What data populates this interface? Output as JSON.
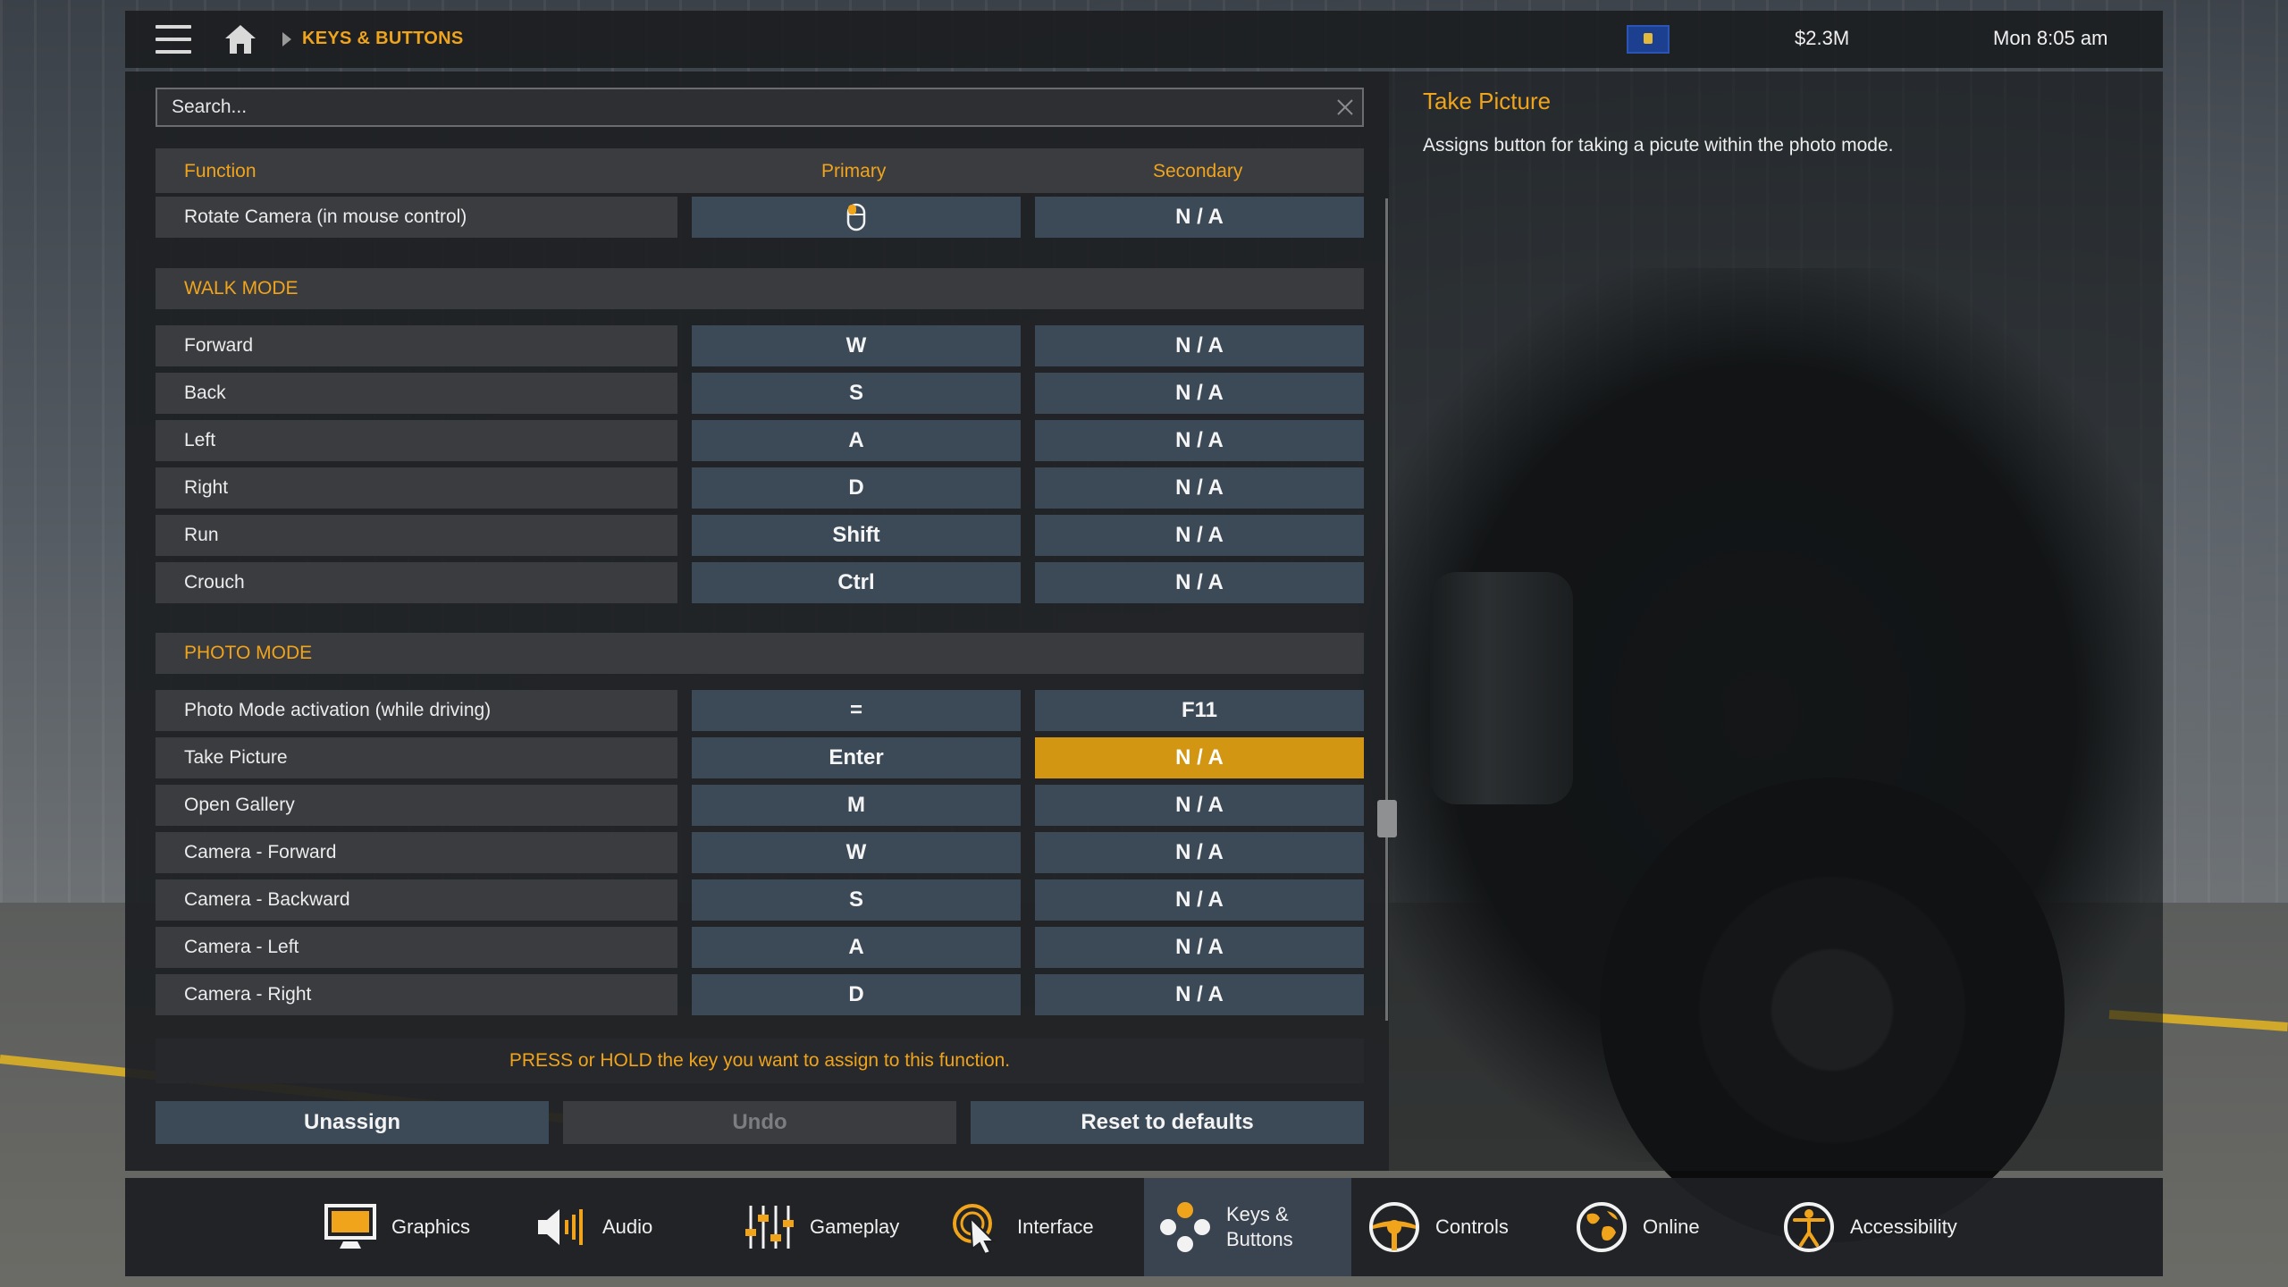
{
  "topbar": {
    "breadcrumb": "KEYS & BUTTONS",
    "money": "$2.3M",
    "time": "Mon 8:05 am"
  },
  "search": {
    "placeholder": "Search..."
  },
  "table": {
    "headers": {
      "function": "Function",
      "primary": "Primary",
      "secondary": "Secondary"
    },
    "top_row": {
      "function": "Rotate Camera (in mouse control)",
      "primary_icon": "mouse-icon",
      "secondary": "N / A"
    },
    "sections": [
      {
        "title": "WALK MODE",
        "rows": [
          {
            "function": "Forward",
            "primary": "W",
            "secondary": "N / A"
          },
          {
            "function": "Back",
            "primary": "S",
            "secondary": "N / A"
          },
          {
            "function": "Left",
            "primary": "A",
            "secondary": "N / A"
          },
          {
            "function": "Right",
            "primary": "D",
            "secondary": "N / A"
          },
          {
            "function": "Run",
            "primary": "Shift",
            "secondary": "N / A"
          },
          {
            "function": "Crouch",
            "primary": "Ctrl",
            "secondary": "N / A"
          }
        ]
      },
      {
        "title": "PHOTO MODE",
        "rows": [
          {
            "function": "Photo Mode activation (while driving)",
            "primary": "=",
            "secondary": "F11"
          },
          {
            "function": "Take Picture",
            "primary": "Enter",
            "secondary": "N / A"
          },
          {
            "function": "Open Gallery",
            "primary": "M",
            "secondary": "N / A"
          },
          {
            "function": "Camera - Forward",
            "primary": "W",
            "secondary": "N / A"
          },
          {
            "function": "Camera - Backward",
            "primary": "S",
            "secondary": "N / A"
          },
          {
            "function": "Camera - Left",
            "primary": "A",
            "secondary": "N / A"
          },
          {
            "function": "Camera - Right",
            "primary": "D",
            "secondary": "N / A"
          }
        ]
      }
    ]
  },
  "hint": "PRESS or HOLD the key you want to assign to this function.",
  "buttons": {
    "unassign": "Unassign",
    "undo": "Undo",
    "reset": "Reset to defaults"
  },
  "detail": {
    "title": "Take Picture",
    "description": "Assigns button for taking a picute within the photo mode."
  },
  "tabs": [
    {
      "label": "Graphics",
      "icon": "monitor-icon"
    },
    {
      "label": "Audio",
      "icon": "speaker-icon"
    },
    {
      "label": "Gameplay",
      "icon": "sliders-icon"
    },
    {
      "label": "Interface",
      "icon": "cursor-icon"
    },
    {
      "label_line1": "Keys &",
      "label_line2": "Buttons",
      "icon": "keys-buttons-icon",
      "active": true
    },
    {
      "label": "Controls",
      "icon": "steering-wheel-icon"
    },
    {
      "label": "Online",
      "icon": "globe-icon"
    },
    {
      "label": "Accessibility",
      "icon": "accessibility-icon"
    }
  ],
  "colors": {
    "accent": "#f0a41c",
    "selected_cell": "#d29612",
    "key_cell": "#3c4a58",
    "active_tab": "#3a4350"
  }
}
